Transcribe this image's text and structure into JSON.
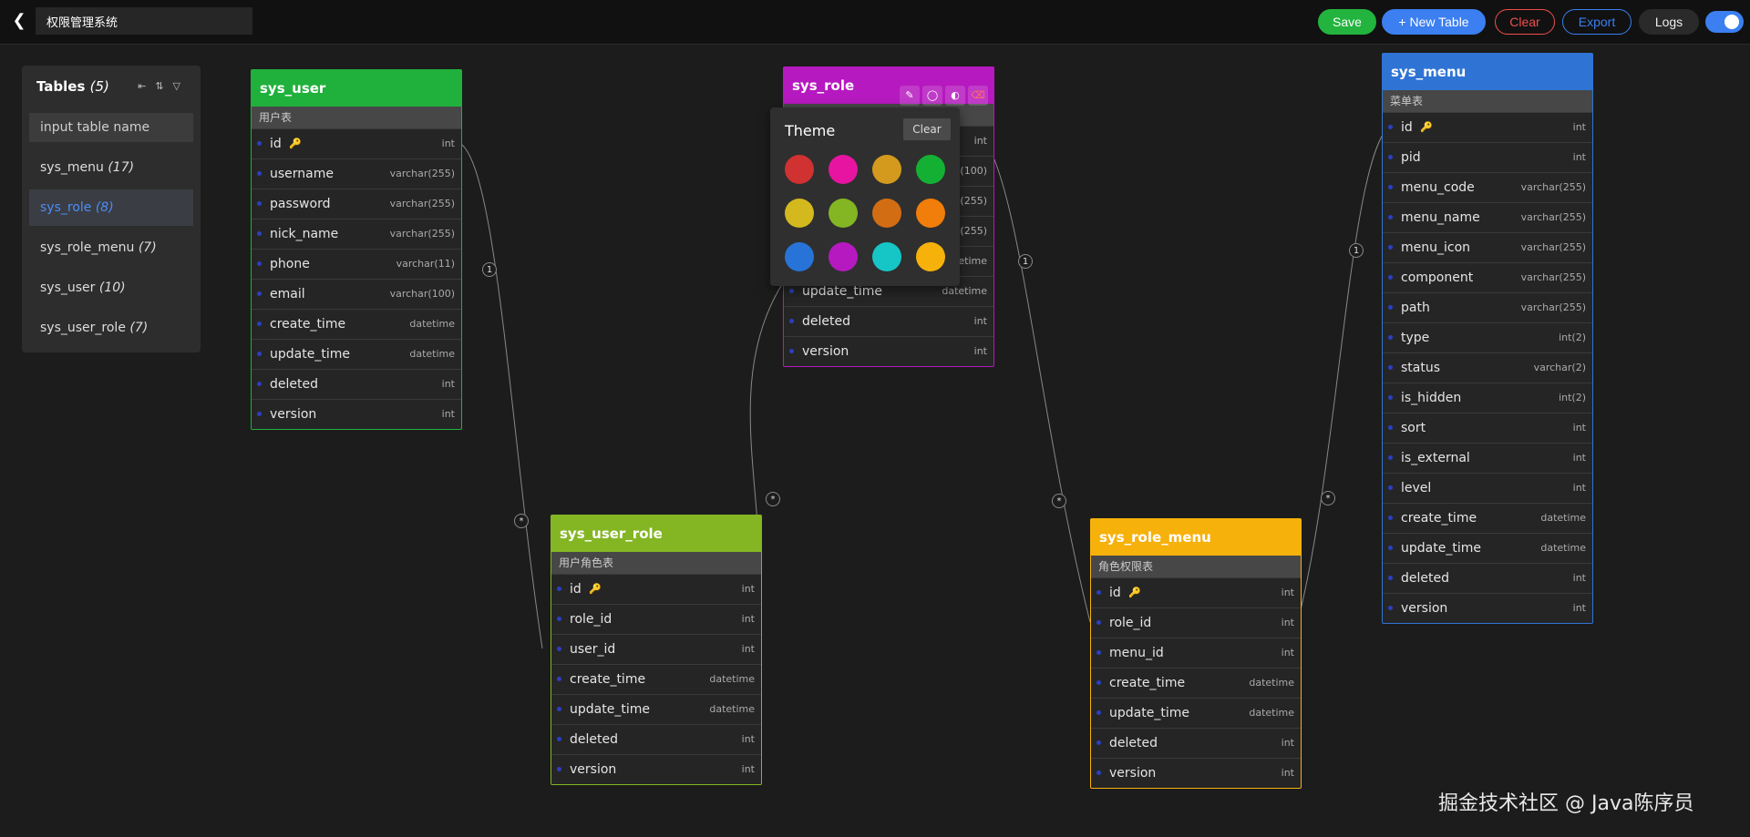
{
  "header": {
    "title": "权限管理系统",
    "buttons": {
      "save": "Save",
      "new_table": "+ New Table",
      "clear": "Clear",
      "export": "Export",
      "logs": "Logs"
    }
  },
  "sidebar": {
    "title": "Tables",
    "count": "(5)",
    "search_placeholder": "input table name",
    "items": [
      {
        "name": "sys_menu",
        "count": "(17)"
      },
      {
        "name": "sys_role",
        "count": "(8)"
      },
      {
        "name": "sys_role_menu",
        "count": "(7)"
      },
      {
        "name": "sys_user",
        "count": "(10)"
      },
      {
        "name": "sys_user_role",
        "count": "(7)"
      }
    ]
  },
  "entities": {
    "sys_user": {
      "name": "sys_user",
      "comment": "用户表",
      "color": "#1fb13c",
      "fields": [
        {
          "name": "id",
          "type": "int",
          "key": true
        },
        {
          "name": "username",
          "type": "varchar(255)"
        },
        {
          "name": "password",
          "type": "varchar(255)"
        },
        {
          "name": "nick_name",
          "type": "varchar(255)"
        },
        {
          "name": "phone",
          "type": "varchar(11)"
        },
        {
          "name": "email",
          "type": "varchar(100)"
        },
        {
          "name": "create_time",
          "type": "datetime"
        },
        {
          "name": "update_time",
          "type": "datetime"
        },
        {
          "name": "deleted",
          "type": "int"
        },
        {
          "name": "version",
          "type": "int"
        }
      ]
    },
    "sys_role": {
      "name": "sys_role",
      "color": "#b619bf",
      "fields": [
        {
          "name": "",
          "type": "int"
        },
        {
          "name": "",
          "type": "(100)"
        },
        {
          "name": "",
          "type": "(255)"
        },
        {
          "name": "",
          "type": "(255)"
        },
        {
          "name": "",
          "type": "etime"
        },
        {
          "name": "update_time",
          "type": "datetime"
        },
        {
          "name": "deleted",
          "type": "int"
        },
        {
          "name": "version",
          "type": "int"
        }
      ]
    },
    "sys_menu": {
      "name": "sys_menu",
      "comment": "菜单表",
      "color": "#2f74d4",
      "fields": [
        {
          "name": "id",
          "type": "int",
          "key": true
        },
        {
          "name": "pid",
          "type": "int"
        },
        {
          "name": "menu_code",
          "type": "varchar(255)"
        },
        {
          "name": "menu_name",
          "type": "varchar(255)"
        },
        {
          "name": "menu_icon",
          "type": "varchar(255)"
        },
        {
          "name": "component",
          "type": "varchar(255)"
        },
        {
          "name": "path",
          "type": "varchar(255)"
        },
        {
          "name": "type",
          "type": "int(2)"
        },
        {
          "name": "status",
          "type": "varchar(2)"
        },
        {
          "name": "is_hidden",
          "type": "int(2)"
        },
        {
          "name": "sort",
          "type": "int"
        },
        {
          "name": "is_external",
          "type": "int"
        },
        {
          "name": "level",
          "type": "int"
        },
        {
          "name": "create_time",
          "type": "datetime"
        },
        {
          "name": "update_time",
          "type": "datetime"
        },
        {
          "name": "deleted",
          "type": "int"
        },
        {
          "name": "version",
          "type": "int"
        }
      ]
    },
    "sys_user_role": {
      "name": "sys_user_role",
      "comment": "用户角色表",
      "color": "#84b624",
      "fields": [
        {
          "name": "id",
          "type": "int",
          "key": true
        },
        {
          "name": "role_id",
          "type": "int"
        },
        {
          "name": "user_id",
          "type": "int"
        },
        {
          "name": "create_time",
          "type": "datetime"
        },
        {
          "name": "update_time",
          "type": "datetime"
        },
        {
          "name": "deleted",
          "type": "int"
        },
        {
          "name": "version",
          "type": "int"
        }
      ]
    },
    "sys_role_menu": {
      "name": "sys_role_menu",
      "comment": "角色权限表",
      "color": "#f6b10b",
      "fields": [
        {
          "name": "id",
          "type": "int",
          "key": true
        },
        {
          "name": "role_id",
          "type": "int"
        },
        {
          "name": "menu_id",
          "type": "int"
        },
        {
          "name": "create_time",
          "type": "datetime"
        },
        {
          "name": "update_time",
          "type": "datetime"
        },
        {
          "name": "deleted",
          "type": "int"
        },
        {
          "name": "version",
          "type": "int"
        }
      ]
    }
  },
  "theme_popover": {
    "title": "Theme",
    "clear": "Clear",
    "colors": [
      "#d03131",
      "#e614a0",
      "#d39a1d",
      "#14b034",
      "#d3b91d",
      "#84b624",
      "#d36d14",
      "#f17d0a",
      "#2873d8",
      "#b619bf",
      "#16c6c6",
      "#f6b10b"
    ]
  },
  "relations": {
    "one": "1",
    "many": "*"
  },
  "watermark": "掘金技术社区 @ Java陈序员"
}
